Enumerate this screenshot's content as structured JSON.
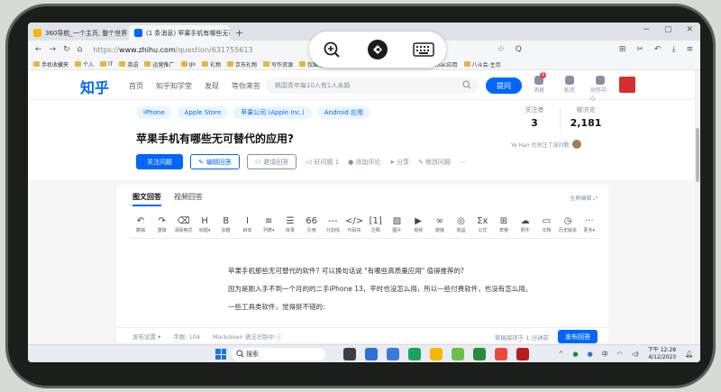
{
  "browser": {
    "tabs": [
      {
        "title": "360导航_一个主页, 整个世界",
        "color": "#f7b500"
      },
      {
        "title": "(1 条消息) 苹果手机有哪些无可替代的应用",
        "color": "#0066ff"
      }
    ],
    "new_tab": "+",
    "address": {
      "scheme": "https://",
      "host": "www.zhihu.com",
      "path": "/question/631755613"
    },
    "search_placeholder": "Q",
    "bookmarks": [
      "手机收藏夹",
      "个人",
      "IT",
      "英语",
      "运营推广",
      "go",
      "礼物",
      "京东礼物",
      "写作资源",
      "仅面者：好课程（13",
      "仅面者：周边商数码",
      "mac应用",
      "八斗会-主页"
    ]
  },
  "overlay": {
    "zoom_icon": "zoom-in-icon",
    "disconnect_icon": "disconnect-icon",
    "keyboard_icon": "keyboard-icon"
  },
  "zhihu": {
    "logo": "知乎",
    "nav": [
      "首页",
      "知乎知学堂",
      "发现",
      "等你来答"
    ],
    "search_placeholder": "韩国青年每10人有1人未婚",
    "ask_label": "提问",
    "icons": [
      {
        "label": "消息",
        "badge": "1"
      },
      {
        "label": "私信",
        "badge": ""
      },
      {
        "label": "创作中心",
        "badge": ""
      }
    ]
  },
  "question": {
    "topics": [
      "iPhone",
      "Apple Store",
      "苹果公司 (Apple Inc.)",
      "Android 应用"
    ],
    "title": "苹果手机有哪些无可替代的应用?",
    "followers_label": "关注者",
    "followers": "3",
    "views_label": "被浏览",
    "views": "2,181",
    "follower_note": "Ye Han 也关注了该问题",
    "actions": {
      "follow": "关注问题",
      "write": "编辑回答",
      "invite": "邀请回答",
      "good": "好问题 1",
      "comment": "添加评论",
      "share": "分享",
      "edit": "修改问题",
      "more": "···"
    }
  },
  "editor": {
    "tabs": [
      "图文回答",
      "视频回答"
    ],
    "fullscreen": "全屏编辑",
    "tools": [
      {
        "glyph": "↶",
        "label": "撤销"
      },
      {
        "glyph": "↷",
        "label": "重做"
      },
      {
        "glyph": "⌫",
        "label": "清除格式"
      },
      {
        "glyph": "H",
        "label": "标题▾"
      },
      {
        "glyph": "B",
        "label": "加粗"
      },
      {
        "glyph": "I",
        "label": "斜体"
      },
      {
        "glyph": "≡",
        "label": "列表▾"
      },
      {
        "glyph": "☰",
        "label": "目录"
      },
      {
        "glyph": "66",
        "label": "引用"
      },
      {
        "glyph": "---",
        "label": "分割线"
      },
      {
        "glyph": "</>",
        "label": "代码块"
      },
      {
        "glyph": "[1]",
        "label": "注释"
      },
      {
        "glyph": "▨",
        "label": "图片"
      },
      {
        "glyph": "▶",
        "label": "视频"
      },
      {
        "glyph": "∞",
        "label": "链接"
      },
      {
        "glyph": "◎",
        "label": "收益"
      },
      {
        "glyph": "Σx",
        "label": "公式"
      },
      {
        "glyph": "⊞",
        "label": "表格"
      },
      {
        "glyph": "☁",
        "label": "附件"
      },
      {
        "glyph": "▭",
        "label": "文档"
      },
      {
        "glyph": "◷",
        "label": "历史版本"
      },
      {
        "glyph": "···",
        "label": "更多▾"
      }
    ],
    "paragraphs": [
      "苹果手机那些无可替代的软件? 可以换句话说 \"有哪些高质量应用\" 值得推荐的?",
      "因为是刚入手不到一个月的的二手iPhone 13，平时也没怎么用，所以一些付费软件，也没有怎么用。",
      "一些工具类软件，觉得挺不错的:"
    ],
    "footer": {
      "settings": "发布设置 ▾",
      "word_count": "字数: 104",
      "markdown": "Markdown 语法识别中 ⓘ",
      "draft": "草稿保存于 1 分钟前",
      "publish": "发布回答"
    }
  },
  "taskbar": {
    "search": "搜索",
    "tray": [
      "^",
      "中"
    ],
    "time": "下午 12:28",
    "date": "4/12/2023",
    "apps": [
      "#3d3d3d",
      "#2e6fd8",
      "#3a7bd5",
      "#1aa35f",
      "#f5b800",
      "#6cc04a",
      "#2b8a3e",
      "#e94a3c",
      "#b71c1c"
    ]
  }
}
